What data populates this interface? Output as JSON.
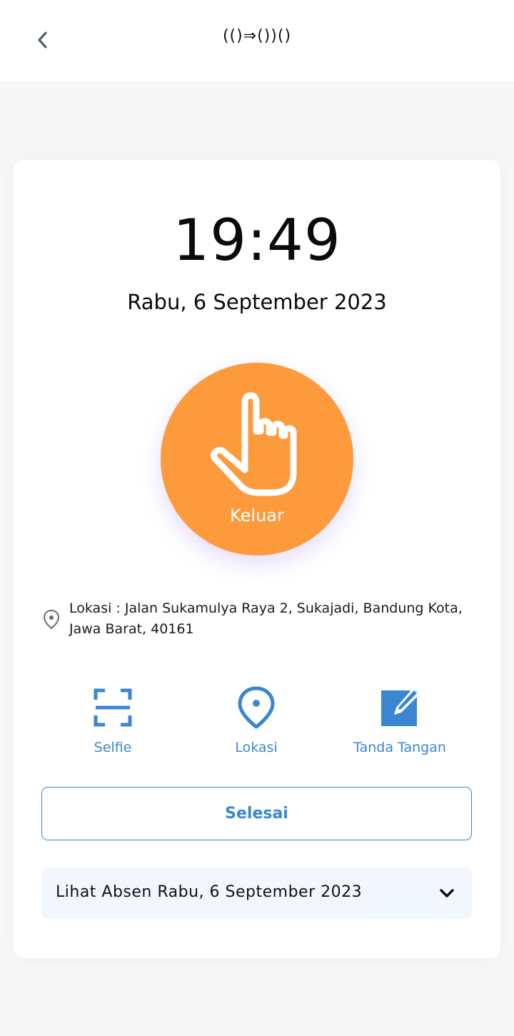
{
  "header": {
    "title": "(()⇒())()",
    "back_icon": "chevron-left-icon"
  },
  "attendance": {
    "time": "19:49",
    "date": "Rabu, 6 September 2023",
    "punch_label": "Keluar",
    "punch_icon": "hand-pointer-icon",
    "punch_color": "#fd9a3c"
  },
  "location": {
    "icon": "map-pin-icon",
    "text": "Lokasi : Jalan Sukamulya Raya 2, Sukajadi, Bandung Kota, Jawa Barat, 40161"
  },
  "actions": [
    {
      "label": "Selfie",
      "icon": "face-scan-icon"
    },
    {
      "label": "Lokasi",
      "icon": "location-pin-icon"
    },
    {
      "label": "Tanda Tangan",
      "icon": "signature-edit-icon"
    }
  ],
  "finish_button": {
    "label": "Selesai"
  },
  "history": {
    "label": "Lihat Absen Rabu, 6 September 2023",
    "icon": "chevron-down-icon"
  },
  "colors": {
    "accent": "#3a86d1",
    "orange": "#fd9a3c"
  }
}
